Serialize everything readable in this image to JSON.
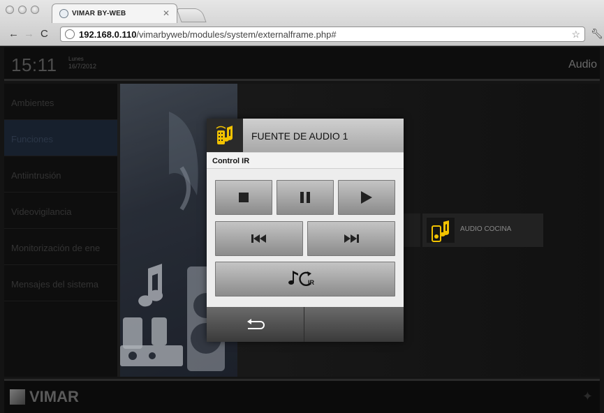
{
  "browser": {
    "tab_title": "VIMAR BY-WEB",
    "url_host": "192.168.0.110",
    "url_path": "/vimarbyweb/modules/system/externalframe.php#"
  },
  "header": {
    "time": "15:11",
    "day": "Lunes",
    "date": "16/7/2012",
    "section": "Audio"
  },
  "sidebar": {
    "items": [
      {
        "label": "Ambientes"
      },
      {
        "label": "Funciones"
      },
      {
        "label": "Antiintrusión"
      },
      {
        "label": "Videovigilancia"
      },
      {
        "label": "Monitorización de ene"
      },
      {
        "label": "Mensajes del sistema"
      }
    ]
  },
  "content": {
    "device_tile": "AUDIO COCINA"
  },
  "dialog": {
    "title": "FUENTE DE AUDIO 1",
    "subtitle": "Control IR",
    "ir_label": "IR"
  },
  "footer": {
    "logo": "VIMAR"
  },
  "colors": {
    "accent_yellow": "#f2c200",
    "dialog_body": "#ededed",
    "app_bg": "#141414"
  }
}
